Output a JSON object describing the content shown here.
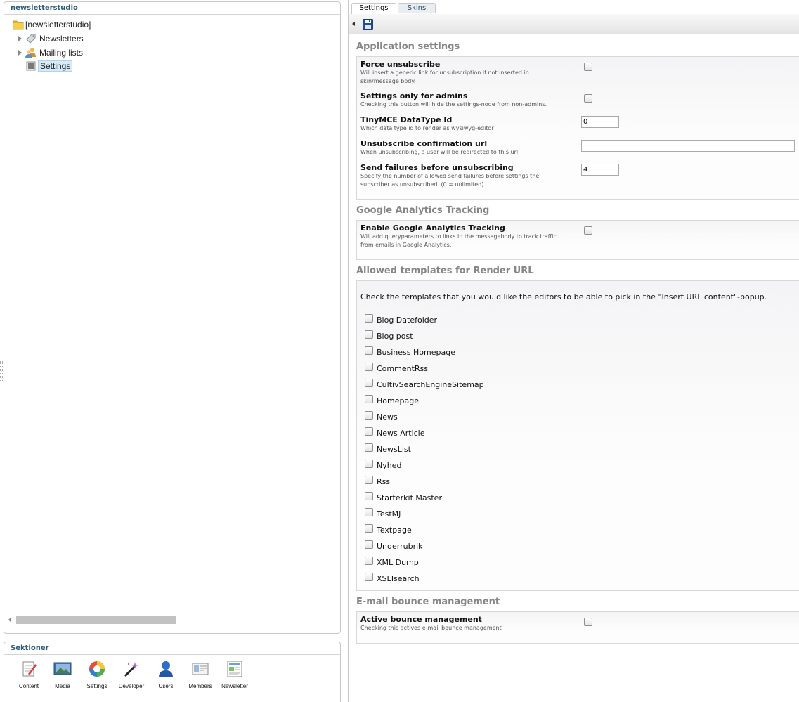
{
  "tree": {
    "header": "newsletterstudio",
    "root_label": "[newsletterstudio]",
    "nodes": [
      {
        "label": "Newsletters",
        "icon": "newsletter-tag-icon"
      },
      {
        "label": "Mailing lists",
        "icon": "users-group-icon"
      },
      {
        "label": "Settings",
        "icon": "settings-icon",
        "selected": true
      }
    ]
  },
  "sections": {
    "header": "Sektioner",
    "apps": [
      {
        "name": "Content",
        "icon": "content-icon"
      },
      {
        "name": "Media",
        "icon": "media-icon"
      },
      {
        "name": "Settings",
        "icon": "settings-wheel-icon"
      },
      {
        "name": "Developer",
        "icon": "developer-wand-icon"
      },
      {
        "name": "Users",
        "icon": "user-icon"
      },
      {
        "name": "Members",
        "icon": "members-card-icon"
      },
      {
        "name": "Newsletter",
        "icon": "newsletter-icon"
      }
    ]
  },
  "tabs": [
    {
      "label": "Settings",
      "active": true
    },
    {
      "label": "Skins",
      "active": false
    }
  ],
  "application_settings": {
    "title": "Application settings",
    "force_unsubscribe": {
      "label": "Force unsubscribe",
      "desc": "Will insert a generic link for unsubscription if not inserted in skin/message body.",
      "checked": false
    },
    "admins_only": {
      "label": "Settings only for admins",
      "desc": "Checking this button will hide the settings-node from non-admins.",
      "checked": false
    },
    "tinymce": {
      "label": "TinyMCE DataType Id",
      "desc": "Which data type id to render as wysiwyg-editor",
      "value": "0"
    },
    "unsub_url": {
      "label": "Unsubscribe confirmation url",
      "desc": "When unsubscribing, a user will be redirected to this url.",
      "value": ""
    },
    "send_failures": {
      "label": "Send failures before unsubscribing",
      "desc": "Specify the number of allowed send failures before settings the subscriber as unsubscribed. (0 = unlimited)",
      "value": "4"
    }
  },
  "google_analytics": {
    "title": "Google Analytics Tracking",
    "enable": {
      "label": "Enable Google Analytics Tracking",
      "desc": "Will add queryparameters to links in the messagebody to track traffic from emails in Google Analytics.",
      "checked": false
    }
  },
  "templates": {
    "title": "Allowed templates for Render URL",
    "intro": "Check the templates that you would like the editors to be able to pick in the \"Insert URL content\"-popup.",
    "items": [
      "Blog Datefolder",
      "Blog post",
      "Business Homepage",
      "CommentRss",
      "CultivSearchEngineSitemap",
      "Homepage",
      "News",
      "News Article",
      "NewsList",
      "Nyhed",
      "Rss",
      "Starterkit Master",
      "TestMJ",
      "Textpage",
      "Underrubrik",
      "XML Dump",
      "XSLTsearch"
    ]
  },
  "bounce": {
    "title": "E-mail bounce management",
    "active": {
      "label": "Active bounce management",
      "desc": "Checking this actives e-mail bounce management",
      "checked": false
    }
  }
}
